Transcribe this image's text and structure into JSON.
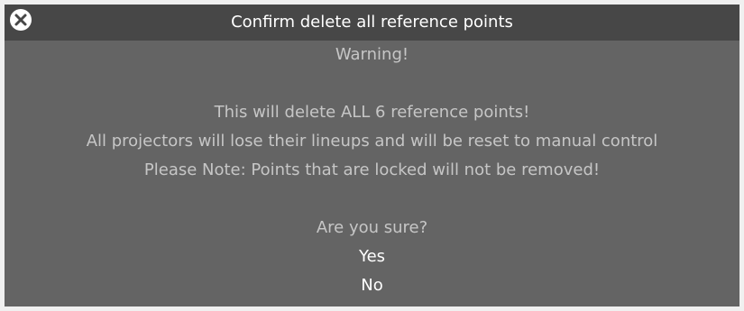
{
  "dialog": {
    "title": "Confirm delete all reference points",
    "close_icon": "close-circle-icon",
    "warning": "Warning!",
    "message_lines": [
      "This will delete ALL 6 reference points!",
      "All projectors will lose their lineups and will be reset to manual control",
      "Please Note: Points that are locked will not be removed!"
    ],
    "question": "Are you sure?",
    "yes_label": "Yes",
    "no_label": "No"
  },
  "colors": {
    "titlebar": "#474747",
    "body": "#646464",
    "text_muted": "#c6c6c6",
    "text_primary": "#ffffff"
  }
}
